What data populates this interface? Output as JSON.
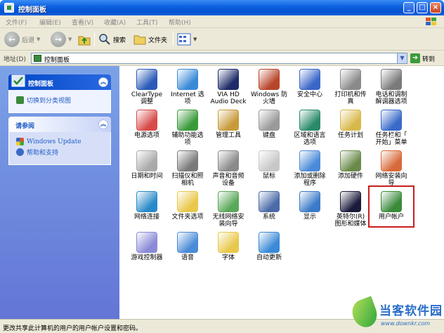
{
  "window": {
    "title": "控制面板"
  },
  "menu": [
    "文件(F)",
    "编辑(E)",
    "查看(V)",
    "收藏(A)",
    "工具(T)",
    "帮助(H)"
  ],
  "toolbar": {
    "back": "后退",
    "search": "搜索",
    "folders": "文件夹"
  },
  "address": {
    "label": "地址(D)",
    "value": "控制面板",
    "go": "转到"
  },
  "sidebar": {
    "panel1": {
      "title": "控制面板",
      "links": [
        "切换到分类视图"
      ]
    },
    "panel2": {
      "title": "请参阅",
      "links": [
        "Windows Update",
        "帮助和支持"
      ]
    }
  },
  "items": [
    {
      "label": "ClearType\n调整",
      "icon": "cleartype-icon",
      "color": "#2a5bb8"
    },
    {
      "label": "Internet 选\n项",
      "icon": "internet-options-icon",
      "color": "#3a8ad8"
    },
    {
      "label": "VIA HD\nAudio Deck",
      "icon": "via-audio-icon",
      "color": "#1e2c6a"
    },
    {
      "label": "Windows 防\n火墙",
      "icon": "firewall-icon",
      "color": "#b8452a"
    },
    {
      "label": "安全中心",
      "icon": "security-center-icon",
      "color": "#3a66c8"
    },
    {
      "label": "打印机和传\n真",
      "icon": "printer-icon",
      "color": "#8a8a8a"
    },
    {
      "label": "电话和调制\n解调器选项",
      "icon": "phone-modem-icon",
      "color": "#7a7a7a"
    },
    {
      "label": "电源选项",
      "icon": "power-options-icon",
      "color": "#d84a4a"
    },
    {
      "label": "辅助功能选\n项",
      "icon": "accessibility-icon",
      "color": "#3a9a3a"
    },
    {
      "label": "管理工具",
      "icon": "admin-tools-icon",
      "color": "#c89a3a"
    },
    {
      "label": "键盘",
      "icon": "keyboard-icon",
      "color": "#9a9a9a"
    },
    {
      "label": "区域和语言\n选项",
      "icon": "regional-icon",
      "color": "#2a8a6a"
    },
    {
      "label": "任务计划",
      "icon": "scheduled-tasks-icon",
      "color": "#d8b84a"
    },
    {
      "label": "任务栏和「\n开始」菜单",
      "icon": "taskbar-icon",
      "color": "#3a6ac8"
    },
    {
      "label": "日期和时间",
      "icon": "date-time-icon",
      "color": "#aaaaaa"
    },
    {
      "label": "扫描仪和照\n相机",
      "icon": "scanner-icon",
      "color": "#7a7a7a"
    },
    {
      "label": "声音和音频\n设备",
      "icon": "sound-icon",
      "color": "#8a8a8a"
    },
    {
      "label": "鼠标",
      "icon": "mouse-icon",
      "color": "#c8c8c8"
    },
    {
      "label": "添加或删除\n程序",
      "icon": "add-remove-icon",
      "color": "#4a8ad8"
    },
    {
      "label": "添加硬件",
      "icon": "add-hardware-icon",
      "color": "#6a8a4a"
    },
    {
      "label": "网络安装向\n导",
      "icon": "network-wizard-icon",
      "color": "#d86a3a"
    },
    {
      "label": "网络连接",
      "icon": "network-connections-icon",
      "color": "#2a8ac8"
    },
    {
      "label": "文件夹选项",
      "icon": "folder-options-icon",
      "color": "#e8c84a"
    },
    {
      "label": "无线网络安\n装向导",
      "icon": "wireless-icon",
      "color": "#5aa85a"
    },
    {
      "label": "系统",
      "icon": "system-icon",
      "color": "#4a6aa8"
    },
    {
      "label": "显示",
      "icon": "display-icon",
      "color": "#3a7ac8"
    },
    {
      "label": "英特尔(R)\n图形和媒体",
      "icon": "intel-graphics-icon",
      "color": "#1a1a3a"
    },
    {
      "label": "用户帐户",
      "icon": "user-accounts-icon",
      "color": "#3a8a3a"
    },
    {
      "label": "游戏控制器",
      "icon": "game-controller-icon",
      "color": "#8a8ad8"
    },
    {
      "label": "语音",
      "icon": "speech-icon",
      "color": "#4a8ad8"
    },
    {
      "label": "字体",
      "icon": "fonts-icon",
      "color": "#e8c84a"
    },
    {
      "label": "自动更新",
      "icon": "auto-update-icon",
      "color": "#3a8ad8"
    }
  ],
  "status": "更改共享此计算机的用户的用户帐户设置和密码。",
  "watermark": {
    "name": "当客软件园",
    "url": "www.downkr.com"
  }
}
